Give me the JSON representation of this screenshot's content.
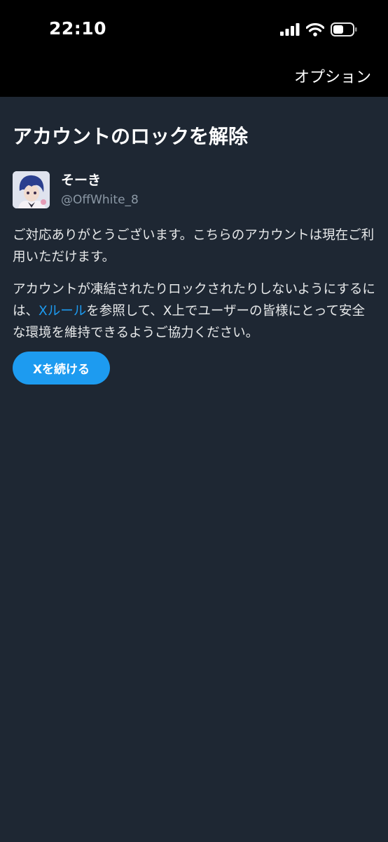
{
  "status_bar": {
    "time": "22:10"
  },
  "header": {
    "options_label": "オプション"
  },
  "main": {
    "title": "アカウントのロックを解除",
    "account": {
      "display_name": "そーき",
      "handle": "@OffWhite_8"
    },
    "paragraph1": "ご対応ありがとうございます。こちらのアカウントは現在ご利用いただけます。",
    "paragraph2": {
      "before_link": "アカウントが凍結されたりロックされたりしないようにするには、",
      "link": "Xルール",
      "after_link": "を参照して、X上でユーザーの皆様にとって安全な環境を維持できるようご協力ください。"
    },
    "continue_label": "Xを続ける"
  },
  "colors": {
    "background": "#1e2733",
    "top_bar": "#000000",
    "accent": "#1d9bf0",
    "secondary_text": "#8b98a5"
  },
  "icons": {
    "signal": "cellular-signal-icon",
    "wifi": "wifi-icon",
    "battery": "battery-icon"
  }
}
